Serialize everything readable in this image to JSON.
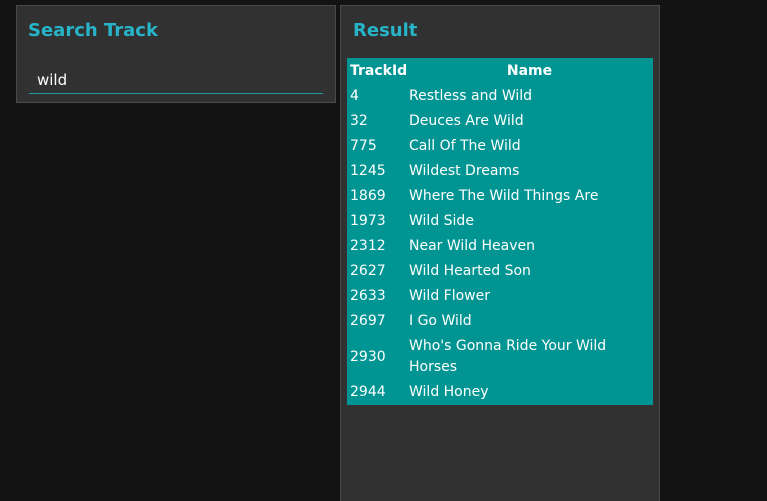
{
  "search_panel": {
    "title": "Search Track",
    "query": "wild"
  },
  "result_panel": {
    "title": "Result",
    "columns": [
      "TrackId",
      "Name"
    ],
    "rows": [
      {
        "id": "4",
        "name": "Restless and Wild"
      },
      {
        "id": "32",
        "name": "Deuces Are Wild"
      },
      {
        "id": "775",
        "name": "Call Of The Wild"
      },
      {
        "id": "1245",
        "name": "Wildest Dreams"
      },
      {
        "id": "1869",
        "name": "Where The Wild Things Are"
      },
      {
        "id": "1973",
        "name": "Wild Side"
      },
      {
        "id": "2312",
        "name": "Near Wild Heaven"
      },
      {
        "id": "2627",
        "name": "Wild Hearted Son"
      },
      {
        "id": "2633",
        "name": "Wild Flower"
      },
      {
        "id": "2697",
        "name": "I Go Wild"
      },
      {
        "id": "2930",
        "name": "Who's Gonna Ride Your Wild Horses"
      },
      {
        "id": "2944",
        "name": "Wild Honey"
      }
    ]
  },
  "colors": {
    "accent": "#27b4c8",
    "table_background": "#009593",
    "panel_background": "#313131",
    "page_background": "#131313"
  }
}
